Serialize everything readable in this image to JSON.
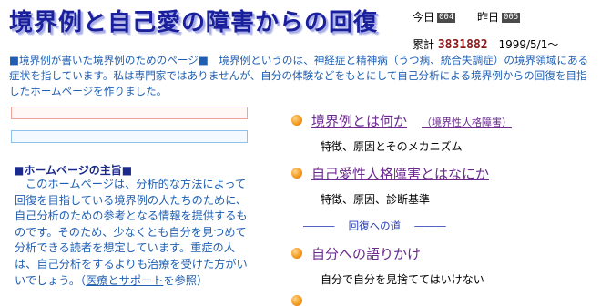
{
  "site_title": "境界例と自己愛の障害からの回復",
  "counters": {
    "today_label": "今日",
    "today_value": "004",
    "yesterday_label": "昨日",
    "yesterday_value": "005",
    "total_label": "累計",
    "total_value": "3831882",
    "since": "1999/5/1～"
  },
  "intro": "■境界例が書いた境界例のためのページ■　境界例というのは、神経症と精神病（うつ病、統合失調症）の境界領域にある症状を指しています。私は専門家ではありませんが、自分の体験などをもとにして自己分析による境界例からの回復を目指したホームページを作りました。",
  "left": {
    "heading": "■ホームページの主旨■",
    "body": "このホームページは、分析的な方法によって回復を目指している境界例の人たちのために、自己分析のための参考となる情報を提供するものです。そのため、少なくとも自分を見つめて分析できる読者を想定しています。重症の人は、自己分析をするよりも治療を受けた方がいいでしょう。（",
    "link": "医療とサポート",
    "suffix": "を参照）"
  },
  "menu": {
    "item1_title": "境界例とは何か",
    "item1_note": "（境界性人格障害）",
    "item1_sub": "特徴、原因とそのメカニズム",
    "item2_title": "自己愛性人格障害とはなにか",
    "item2_sub": "特徴、原因、診断基準",
    "divider": "―――　 回復への道　 ―――",
    "item3_title": "自分への語りかけ",
    "item3_sub": "自分で自分を見捨ててはいけない"
  }
}
